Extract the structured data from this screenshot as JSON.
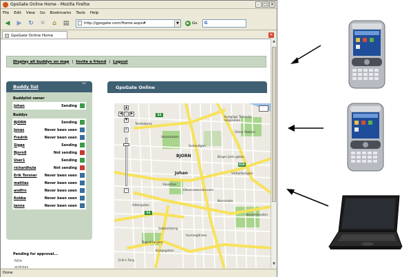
{
  "browser": {
    "title": "GpsGate Online Home - Mozilla Firefox",
    "menu": [
      "File",
      "Edit",
      "View",
      "Go",
      "Bookmarks",
      "Tools",
      "Help"
    ],
    "url": "http://gpsgate.com/Home.aspx#",
    "go_label": "Go",
    "tab_label": "GpsGate Online Home",
    "status": "Done"
  },
  "page": {
    "top_links": [
      "Display all buddys on map",
      "Invite a friend",
      "Logout"
    ],
    "buddy_panel": {
      "title": "Buddy list",
      "owner_label": "Buddylist owner",
      "owner": {
        "name": "Johan",
        "status": "Sending",
        "state": "green"
      },
      "buddys_label": "Buddys",
      "buddys": [
        {
          "name": "BJORN",
          "status": "Sending",
          "state": "green"
        },
        {
          "name": "Jonas",
          "status": "Never been seen",
          "state": "blue"
        },
        {
          "name": "Fredrik",
          "status": "Never been seen",
          "state": "blue"
        },
        {
          "name": "Sigge",
          "status": "Sending",
          "state": "green"
        },
        {
          "name": "Bjorn8",
          "status": "Not sending",
          "state": "red"
        },
        {
          "name": "User1",
          "status": "Sending",
          "state": "green"
        },
        {
          "name": "richardhula",
          "status": "Not sending",
          "state": "red"
        },
        {
          "name": "Erik Torsner",
          "status": "Never been seen",
          "state": "blue"
        },
        {
          "name": "mattias",
          "status": "Never been seen",
          "state": "blue"
        },
        {
          "name": "andfro",
          "status": "Never been seen",
          "state": "blue"
        },
        {
          "name": "Kobba",
          "status": "Never been seen",
          "state": "blue"
        },
        {
          "name": "Janne",
          "status": "Never been seen",
          "state": "blue"
        }
      ],
      "pending_label": "Pending for approval...",
      "pending": [
        "Nille",
        "andreas"
      ]
    },
    "gps_panel": {
      "title": "GpsGate Online",
      "map": {
        "markers": [
          "BJORN",
          "Johan"
        ],
        "streets": [
          "Vasastaden",
          "Vasastan",
          "Observatorielunden",
          "Norrmalm",
          "Sabbatsberg",
          "Tegnérlunden",
          "Kungliga Tekniska Högskolan",
          "Tomteboda",
          "Vanadislunden",
          "Valhallavägen",
          "Sveavägen",
          "Odengatan",
          "Birger Jarls gatan",
          "Humlegården",
          "Erik's Torg",
          "Ostra Station",
          "Kungsgatan"
        ],
        "route_shields": [
          "E20",
          "E4",
          "E4"
        ]
      }
    }
  },
  "colors": {
    "panel_header": "#3f5f72",
    "panel_body": "#c7d6c3",
    "sending": "#3c9a4a",
    "not_sending": "#c73a32",
    "never_seen": "#3b6e9e"
  },
  "devices": [
    "pda-top",
    "pda-middle",
    "laptop-bottom"
  ]
}
